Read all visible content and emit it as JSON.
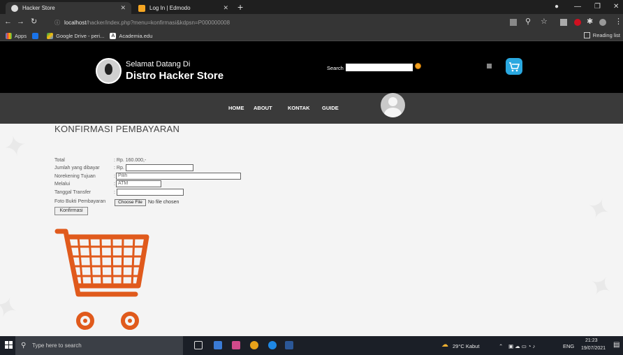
{
  "browser": {
    "tabs": [
      {
        "title": "Hacker Store",
        "active": true
      },
      {
        "title": "Log In | Edmodo",
        "active": false
      }
    ],
    "url_host": "localhost",
    "url_path": "/hacker/index.php?menu=konfirmasi&kdpsn=P000000008",
    "bookmarks": [
      "Apps",
      "Google Drive - peri...",
      "Academia.edu"
    ],
    "reading_list": "Reading list"
  },
  "site": {
    "greeting": "Selamat Datang Di",
    "store_name": "Distro Hacker Store",
    "search_label": "Search",
    "nav": [
      "HOME",
      "ABOUT",
      "KONTAK",
      "GUIDE"
    ]
  },
  "form": {
    "title": "KONFIRMASI PEMBAYARAN",
    "fields": [
      {
        "label": "Total",
        "value": ": Rp. 160.000,-"
      },
      {
        "label": "Jumlah yang dibayar",
        "prefix": ": Rp."
      },
      {
        "label": "Norekening Tujuan",
        "value": "Pilih"
      },
      {
        "label": "Melalui",
        "value": "ATM"
      },
      {
        "label": "Tanggal Transfer",
        "value": ""
      },
      {
        "label": "Foto Bukti Pembayaran",
        "button": "Choose File",
        "status": "No file chosen"
      }
    ],
    "submit": "Konfirmasi"
  },
  "taskbar": {
    "search_placeholder": "Type here to search",
    "weather": "29°C Kabut",
    "lang": "ENG",
    "time": "21:23",
    "date": "19/07/2021"
  },
  "colors": {
    "header_bg": "#000000",
    "nav_bg": "#3a3a3a",
    "cart_orange": "#e05a1c",
    "cart_blue": "#2aa8e0"
  }
}
